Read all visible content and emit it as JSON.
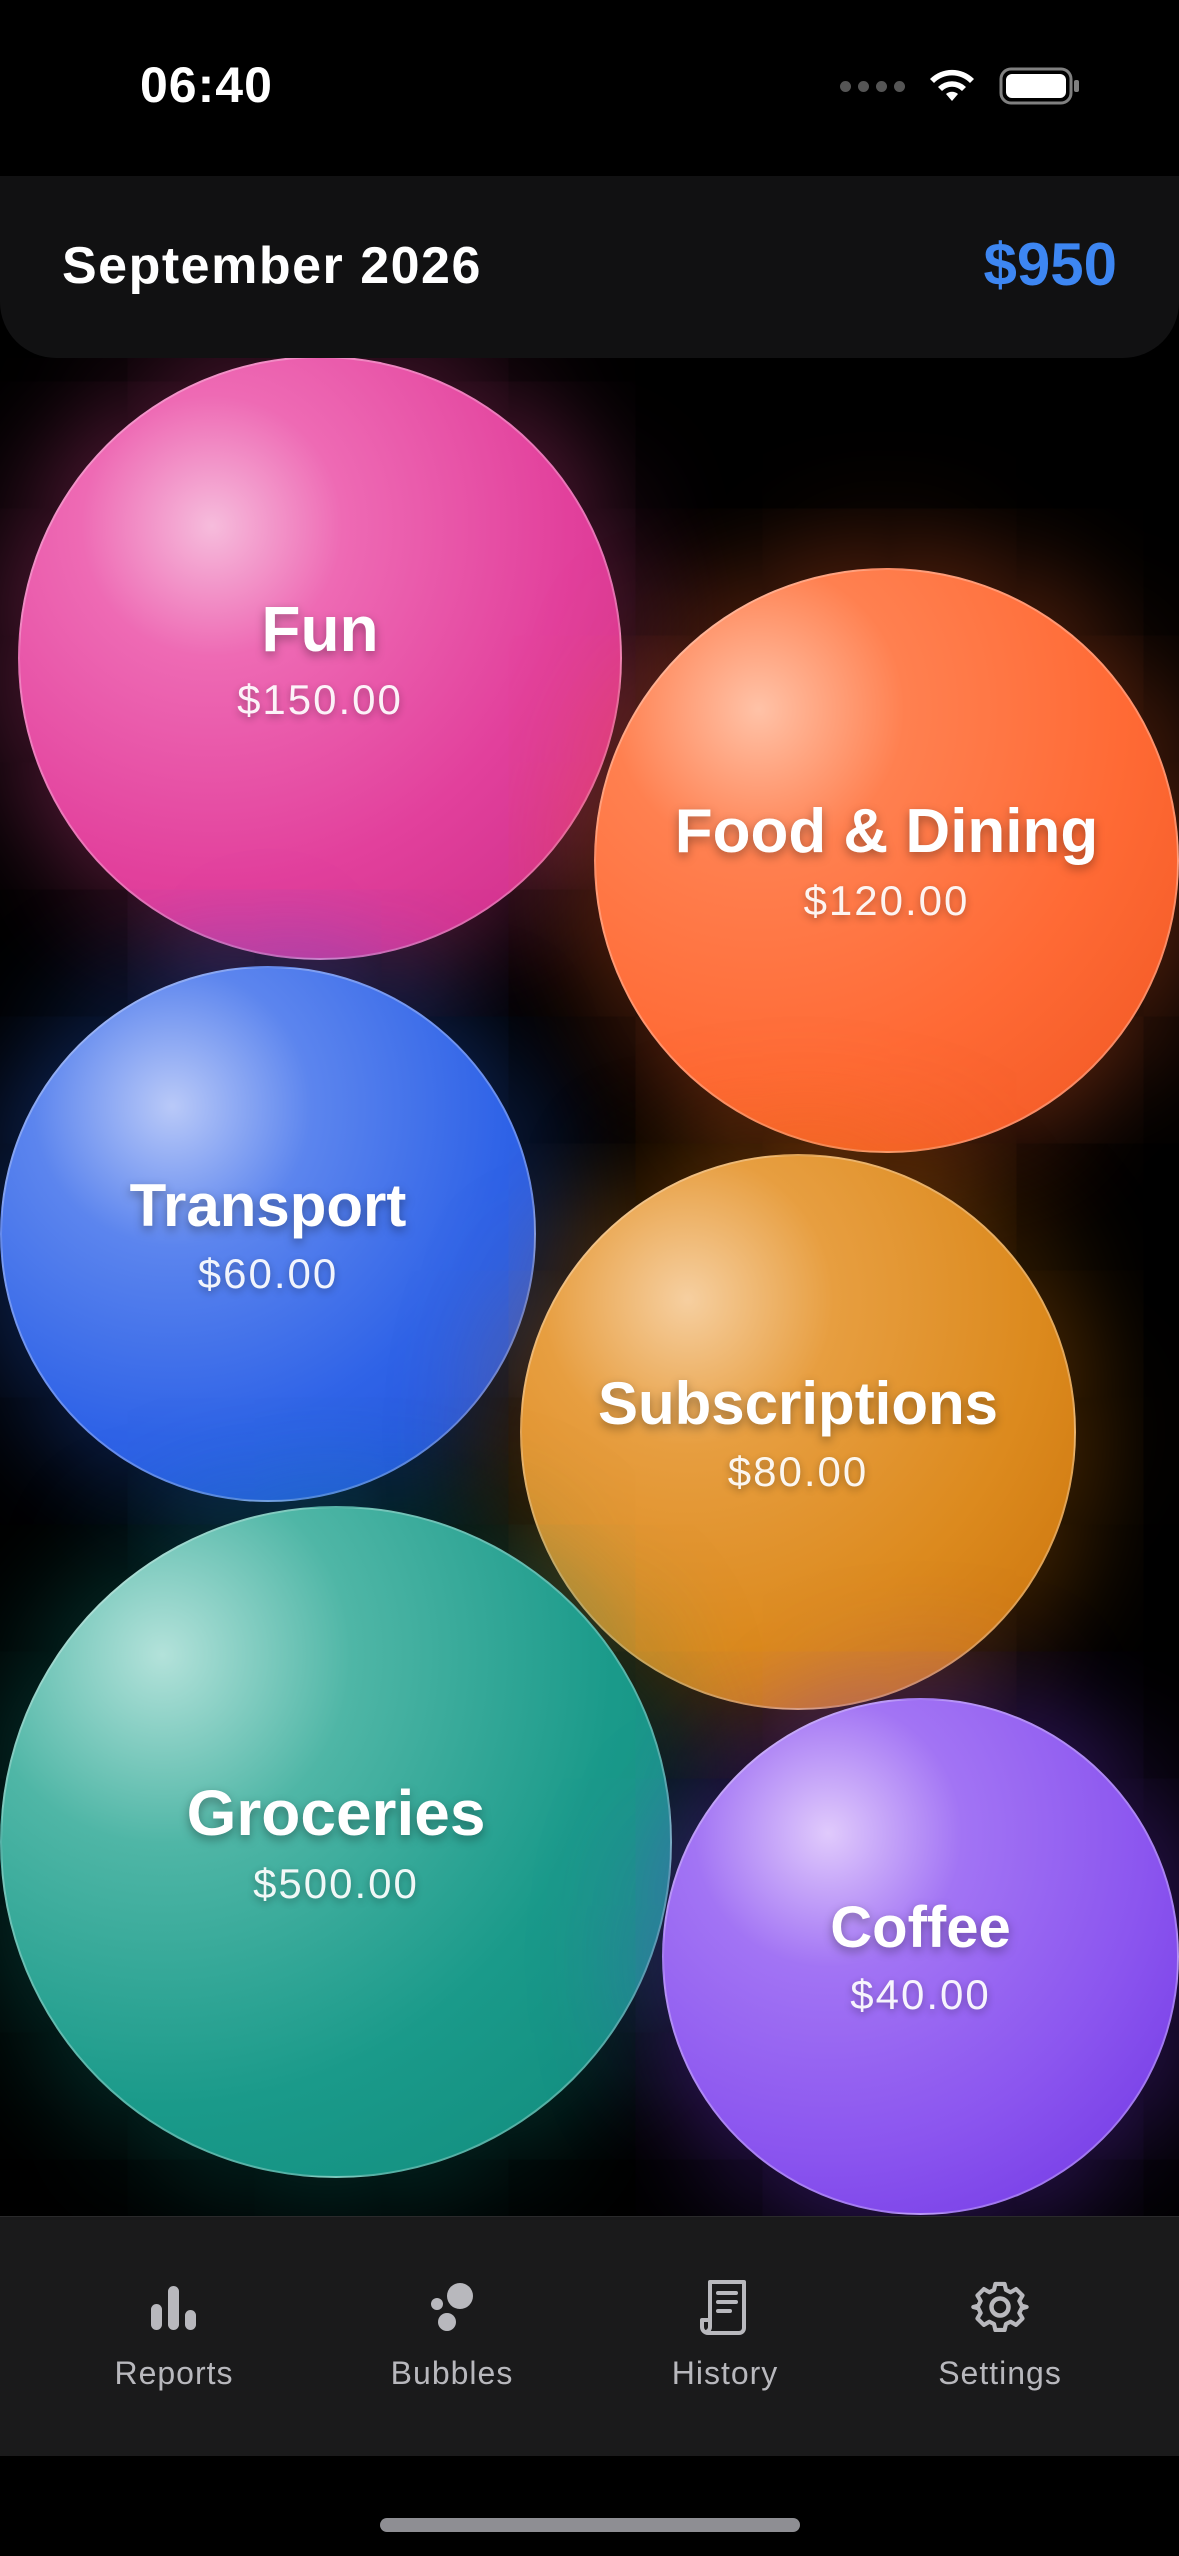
{
  "status_bar": {
    "time": "06:40"
  },
  "header": {
    "month": "September 2026",
    "total": "$950",
    "accent_color": "#3d86f2"
  },
  "bubbles": [
    {
      "name": "Fun",
      "amount": "$150.00",
      "color": "#e2409c"
    },
    {
      "name": "Food & Dining",
      "amount": "$120.00",
      "color": "#ff6a35"
    },
    {
      "name": "Transport",
      "amount": "$60.00",
      "color": "#2f63e7"
    },
    {
      "name": "Subscriptions",
      "amount": "$80.00",
      "color": "#dc8a1e"
    },
    {
      "name": "Groceries",
      "amount": "$500.00",
      "color": "#1a9a8a"
    },
    {
      "name": "Coffee",
      "amount": "$40.00",
      "color": "#8b55ef"
    }
  ],
  "tab_bar": {
    "tabs": [
      {
        "label": "Reports",
        "icon": "bar-chart-icon"
      },
      {
        "label": "Bubbles",
        "icon": "bubbles-icon"
      },
      {
        "label": "History",
        "icon": "receipt-icon"
      },
      {
        "label": "Settings",
        "icon": "gear-icon"
      }
    ]
  }
}
